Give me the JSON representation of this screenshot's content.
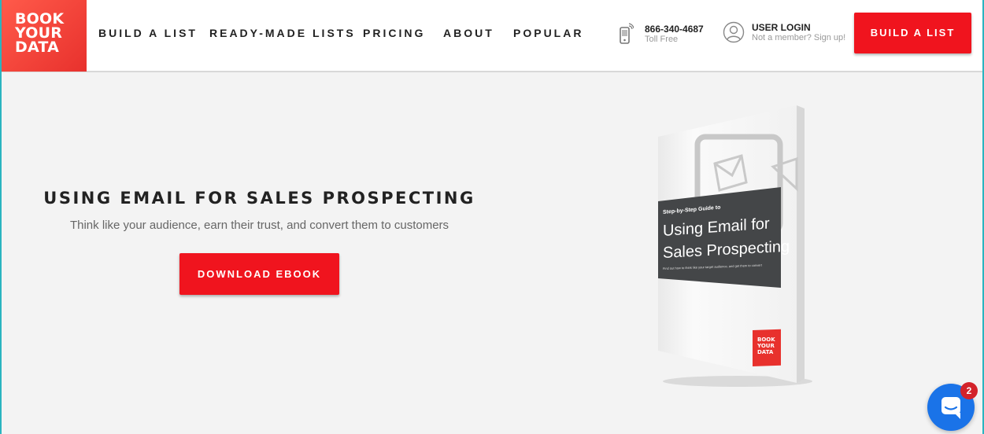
{
  "logo": {
    "lines": [
      "BOOK",
      "YOUR",
      "DATA"
    ]
  },
  "nav": {
    "items": [
      {
        "label": "BUILD A LIST"
      },
      {
        "label": "READY-MADE LISTS"
      },
      {
        "label": "PRICING"
      },
      {
        "label": "ABOUT"
      },
      {
        "label": "POPULAR"
      }
    ]
  },
  "contact": {
    "phone": "866-340-4687",
    "phone_note": "Toll Free"
  },
  "login": {
    "title": "USER LOGIN",
    "subtitle": "Not a member? Sign up!"
  },
  "header_cta": {
    "label": "BUILD A LIST"
  },
  "hero": {
    "title": "USING EMAIL FOR SALES PROSPECTING",
    "subtitle": "Think like your audience, earn their trust, and convert them to customers",
    "cta_label": "DOWNLOAD EBOOK"
  },
  "ebook": {
    "kicker": "Step-by-Step Guide to",
    "title_line1": "Using Email for",
    "title_line2": "Sales Prospecting",
    "tagline": "Find out how to think like your target audience, and get them to convert",
    "logo_lines": [
      "BOOK",
      "YOUR",
      "DATA"
    ]
  },
  "chat": {
    "badge": "2"
  },
  "colors": {
    "brand_red": "#f0141e",
    "logo_red": "#e8312d",
    "chat_blue": "#1a73e8",
    "badge_red": "#d3222a"
  },
  "icons": {
    "phone": "mobile-phone-icon",
    "user": "user-circle-icon",
    "chat": "chat-bubble-icon"
  }
}
